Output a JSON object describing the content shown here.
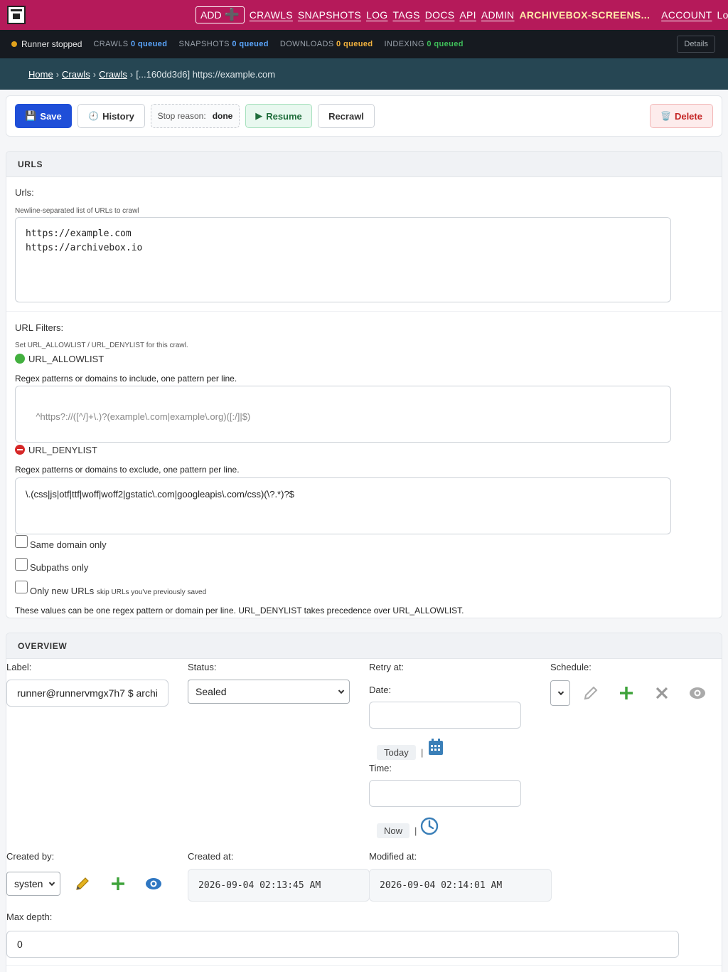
{
  "nav": {
    "add_label": "ADD",
    "links": [
      "CRAWLS",
      "SNAPSHOTS",
      "LOG",
      "TAGS",
      "DOCS",
      "API",
      "ADMIN"
    ],
    "site_name": "ARCHIVEBOX-SCREENS...",
    "account_label": "ACCOUNT",
    "logout_label": "Log out"
  },
  "status": {
    "runner": "Runner stopped",
    "queues": [
      {
        "name": "CRAWLS",
        "value": "0 queued",
        "color": "#5ba7ff"
      },
      {
        "name": "SNAPSHOTS",
        "value": "0 queued",
        "color": "#5ba7ff"
      },
      {
        "name": "DOWNLOADS",
        "value": "0 queued",
        "color": "#f2b23e"
      },
      {
        "name": "INDEXING",
        "value": "0 queued",
        "color": "#3fbf5a"
      }
    ],
    "details_label": "Details"
  },
  "breadcrumb": {
    "home": "Home",
    "crawls_1": "Crawls",
    "crawls_2": "Crawls",
    "current": "[...160dd3d6] https://example.com"
  },
  "actions": {
    "save": "Save",
    "history": "History",
    "stop_reason_label": "Stop reason:",
    "stop_reason_value": "done",
    "resume": "Resume",
    "recrawl": "Recrawl",
    "delete": "Delete"
  },
  "urls_panel": {
    "title": "URLS",
    "urls_label": "Urls:",
    "urls_help": "Newline-separated list of URLs to crawl",
    "urls_value": "https://example.com\nhttps://archivebox.io",
    "filters_label": "URL Filters:",
    "filters_help": "Set URL_ALLOWLIST / URL_DENYLIST for this crawl.",
    "allowlist_title": "URL_ALLOWLIST",
    "allowlist_desc": "Regex patterns or domains to include, one pattern per line.",
    "allowlist_placeholder": "^https?://([^/]+\\.)?(example\\.com|example\\.org)([:/]|$)",
    "denylist_title": "URL_DENYLIST",
    "denylist_desc": "Regex patterns or domains to exclude, one pattern per line.",
    "denylist_value": "\\.(css|js|otf|ttf|woff|woff2|gstatic\\.com|googleapis\\.com/css)(\\?.*)?$",
    "same_domain": "Same domain only",
    "subpaths": "Subpaths only",
    "only_new": "Only new URLs",
    "only_new_help": "skip URLs you've previously saved",
    "footer_note": "These values can be one regex pattern or domain per line. URL_DENYLIST takes precedence over URL_ALLOWLIST."
  },
  "overview": {
    "title": "OVERVIEW",
    "label_label": "Label:",
    "label_value": "runner@runnervmgx7h7 $ archi",
    "status_label": "Status:",
    "status_value": "Sealed",
    "retry_label": "Retry at:",
    "date_label": "Date:",
    "today_label": "Today",
    "time_label": "Time:",
    "now_label": "Now",
    "schedule_label": "Schedule:",
    "created_by_label": "Created by:",
    "created_by_value": "systen",
    "created_at_label": "Created at:",
    "created_at_value": "2026-09-04 02:13:45 AM",
    "modified_at_label": "Modified at:",
    "modified_at_value": "2026-09-04 02:14:01 AM",
    "max_depth_label": "Max depth:",
    "max_depth_value": "0"
  }
}
